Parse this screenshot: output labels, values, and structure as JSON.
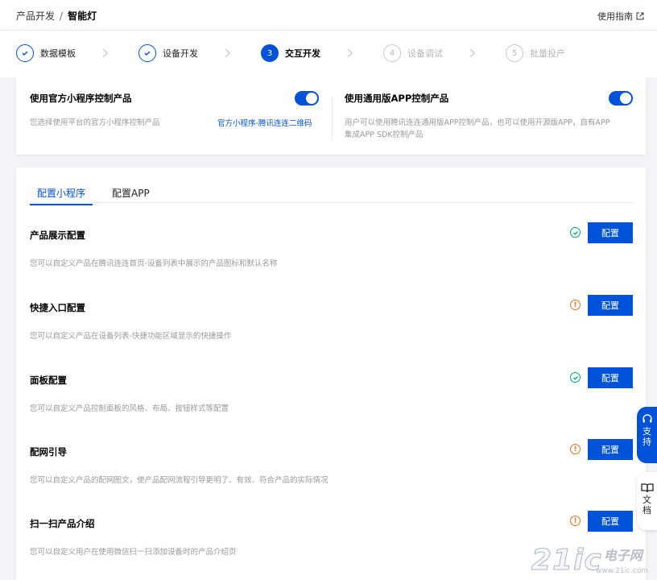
{
  "header": {
    "breadcrumb_parent": "产品开发",
    "breadcrumb_sep": "/",
    "breadcrumb_current": "智能灯",
    "guide_label": "使用指南"
  },
  "steps": [
    {
      "num": "✓",
      "label": "数据模板",
      "state": "done"
    },
    {
      "num": "✓",
      "label": "设备开发",
      "state": "done"
    },
    {
      "num": "3",
      "label": "交互开发",
      "state": "active"
    },
    {
      "num": "4",
      "label": "设备调试",
      "state": "todo"
    },
    {
      "num": "5",
      "label": "批量投产",
      "state": "todo"
    }
  ],
  "options": {
    "mini": {
      "title": "使用官方小程序控制产品",
      "desc": "您选择使用平台的官方小程序控制产品",
      "link": "官方小程序-腾讯连连二维码",
      "enabled": true
    },
    "app": {
      "title": "使用通用版APP控制产品",
      "desc_line1": "用户可以使用腾讯连连通用版APP控制产品，也可以使用开源版APP，自有APP",
      "desc_line2": "集成APP SDK控制产品",
      "enabled": true
    }
  },
  "tabs": [
    {
      "label": "配置小程序",
      "active": true
    },
    {
      "label": "配置APP",
      "active": false
    }
  ],
  "config_rows": [
    {
      "title": "产品展示配置",
      "desc": "您可以自定义产品在腾讯连连首页-设备列表中展示的产品图标和默认名称",
      "status": "ok",
      "button": "配置"
    },
    {
      "title": "快捷入口配置",
      "desc": "您可以自定义产品在设备列表-快捷功能区域显示的快捷操作",
      "status": "warn",
      "button": "配置"
    },
    {
      "title": "面板配置",
      "desc": "您可以自定义产品控制面板的风格、布局、按钮样式等配置",
      "status": "ok",
      "button": "配置"
    },
    {
      "title": "配网引导",
      "desc": "您可以自定义产品的配网图文，使产品配网流程引导更明了、有效、符合产品的实际情况",
      "status": "warn",
      "button": "配置"
    },
    {
      "title": "扫一扫产品介绍",
      "desc": "您可以自定义用户在使用微信扫一扫添加设备时的产品介绍页",
      "status": "warn",
      "button": "配置"
    }
  ],
  "floating": {
    "support_line1": "支",
    "support_line2": "持",
    "doc_line1": "文",
    "doc_line2": "档"
  },
  "watermark": {
    "big": "21ic",
    "cn": "电子网",
    "domain": "www.21ic.com"
  },
  "colors": {
    "primary": "#0052d9",
    "success": "#00a870",
    "warning": "#e37318"
  }
}
